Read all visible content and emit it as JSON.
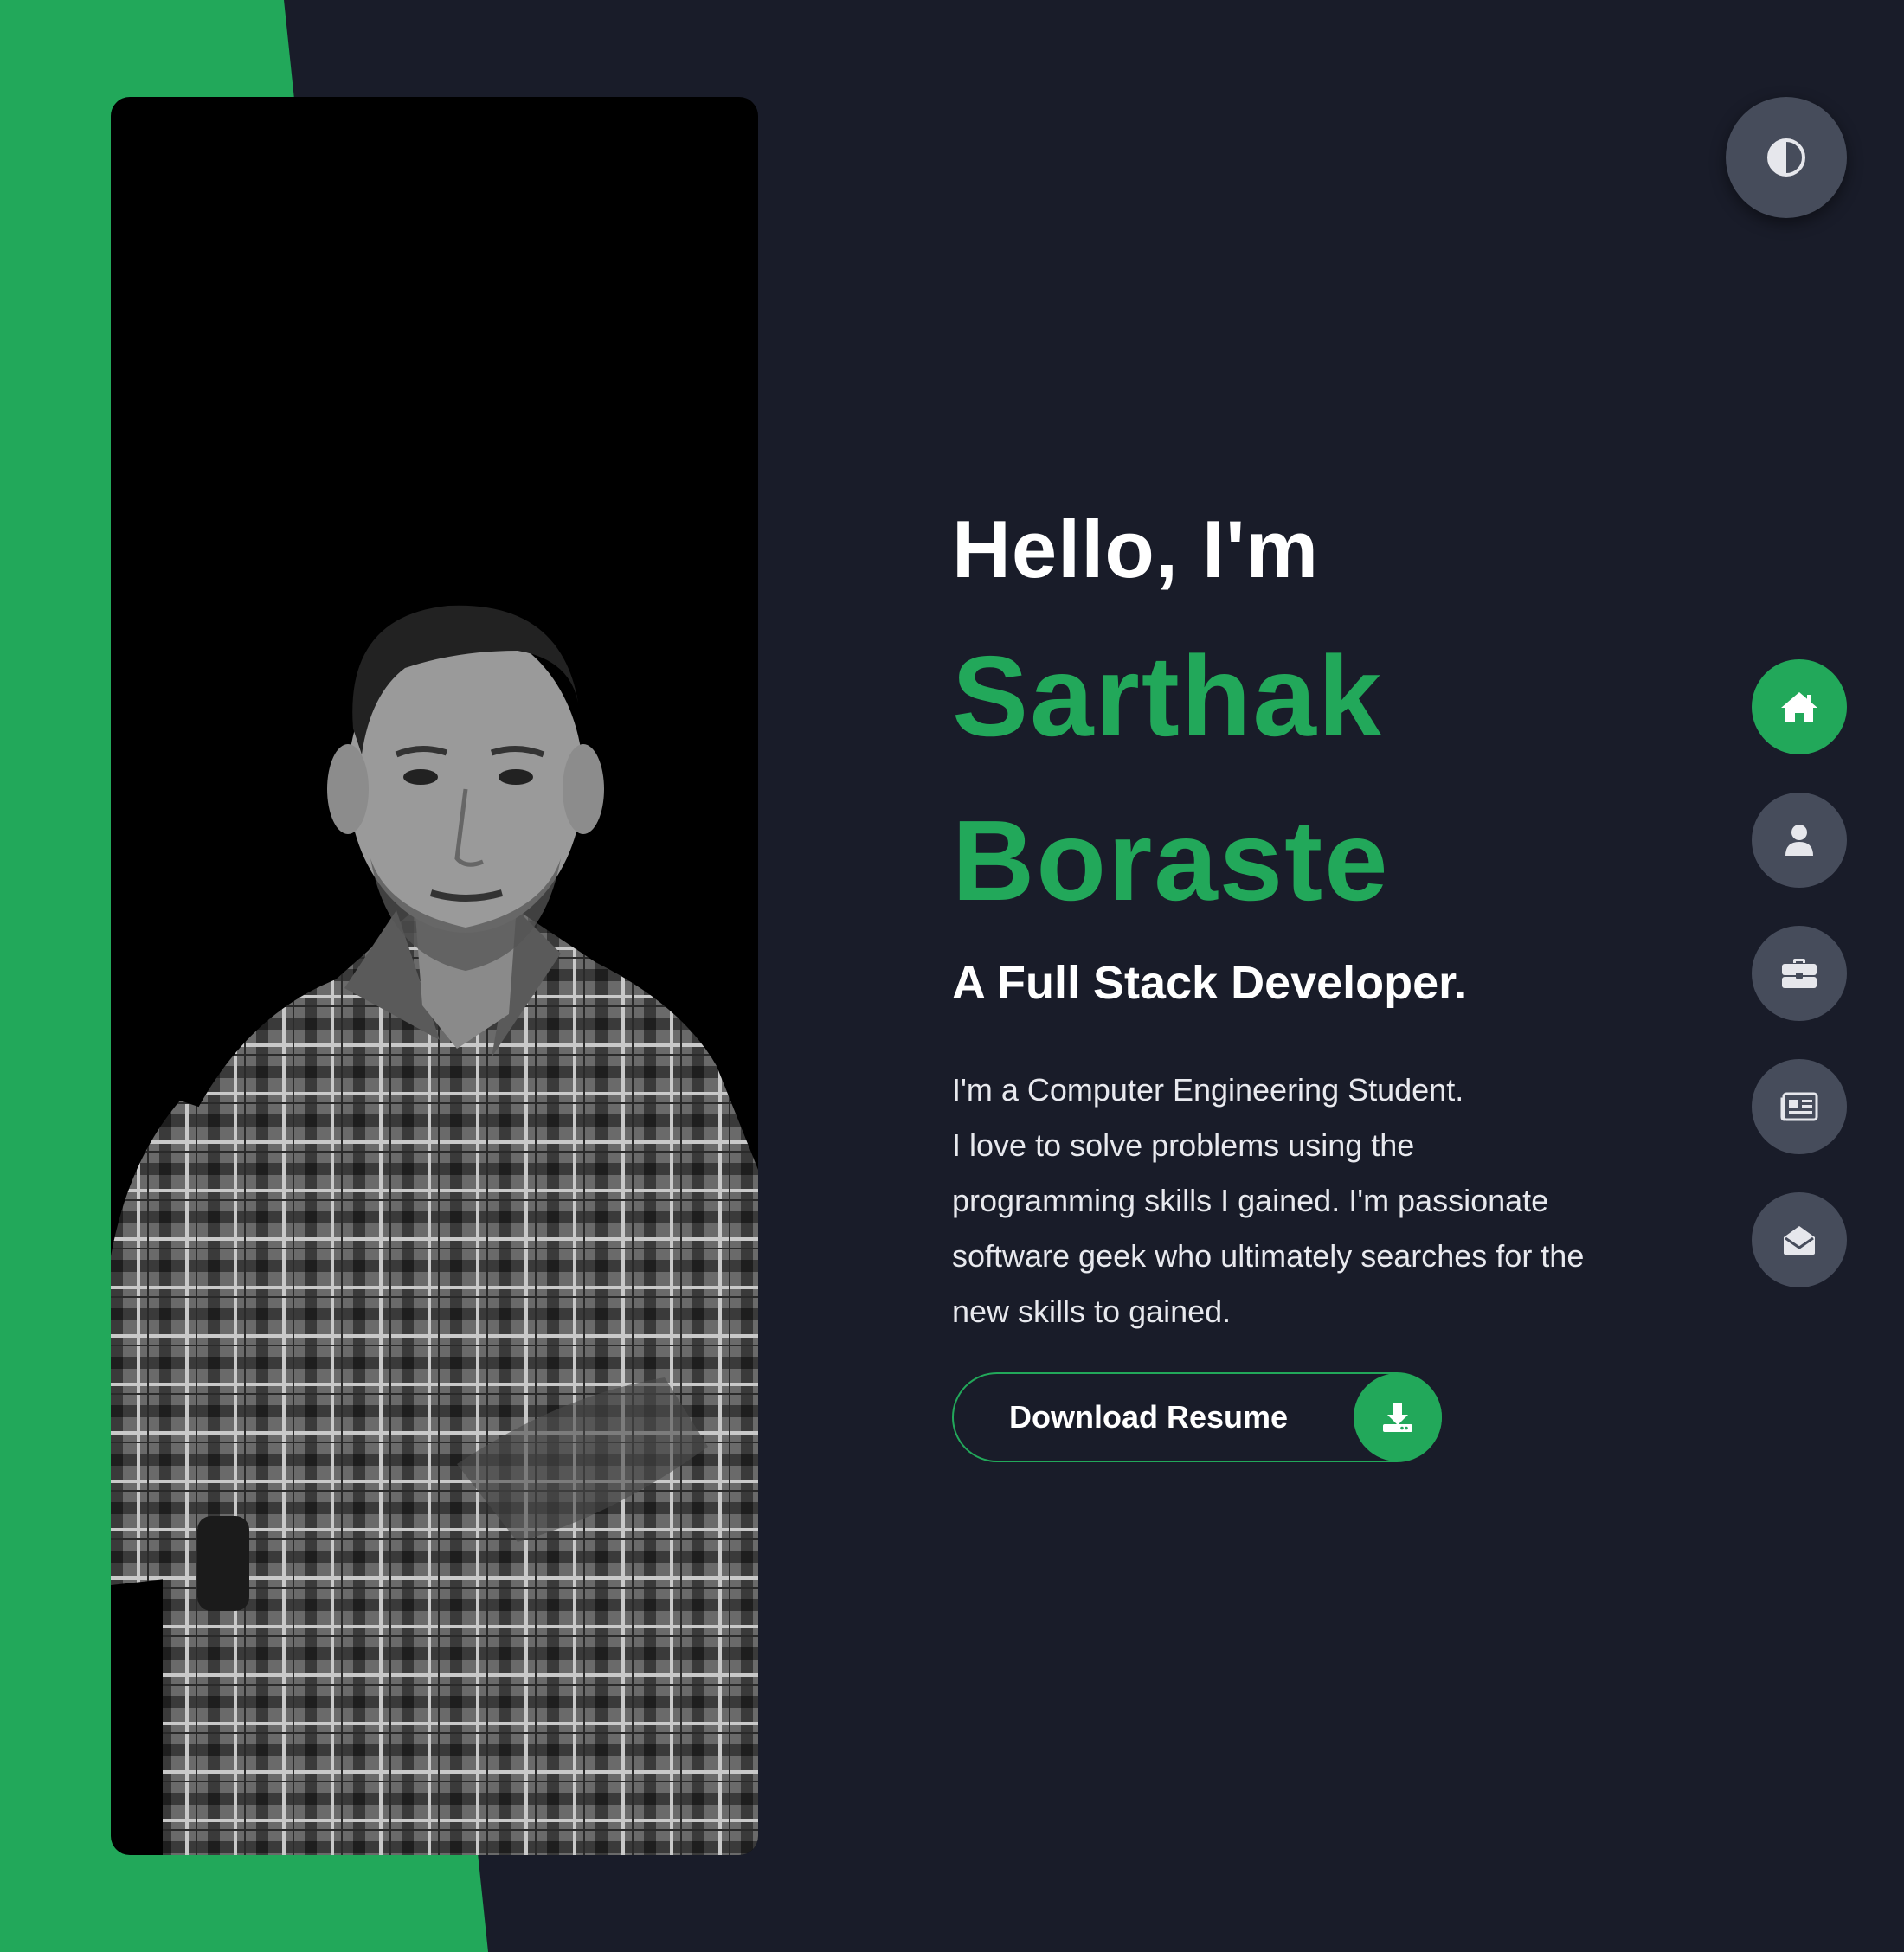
{
  "hero": {
    "greeting": "Hello, I'm",
    "first_name": "Sarthak",
    "last_name": "Boraste",
    "role": "A Full Stack Developer.",
    "bio_lines": [
      "I'm a Computer Engineering Student.",
      "I love to solve problems using the",
      "programming skills I gained. I'm passionate",
      "software geek who ultimately searches for the",
      "new skills to gained."
    ]
  },
  "download_button": {
    "label": "Download Resume",
    "icon": "download-icon"
  },
  "theme_toggle": {
    "icon": "contrast-icon"
  },
  "side_nav": {
    "items": [
      {
        "icon": "home-icon",
        "active": true
      },
      {
        "icon": "user-icon",
        "active": false
      },
      {
        "icon": "briefcase-icon",
        "active": false
      },
      {
        "icon": "newspaper-icon",
        "active": false
      },
      {
        "icon": "envelope-open-icon",
        "active": false
      }
    ]
  },
  "colors": {
    "background": "#191c29",
    "accent": "#22a85a",
    "nav_button": "#464c5b",
    "text": "#ffffff"
  }
}
